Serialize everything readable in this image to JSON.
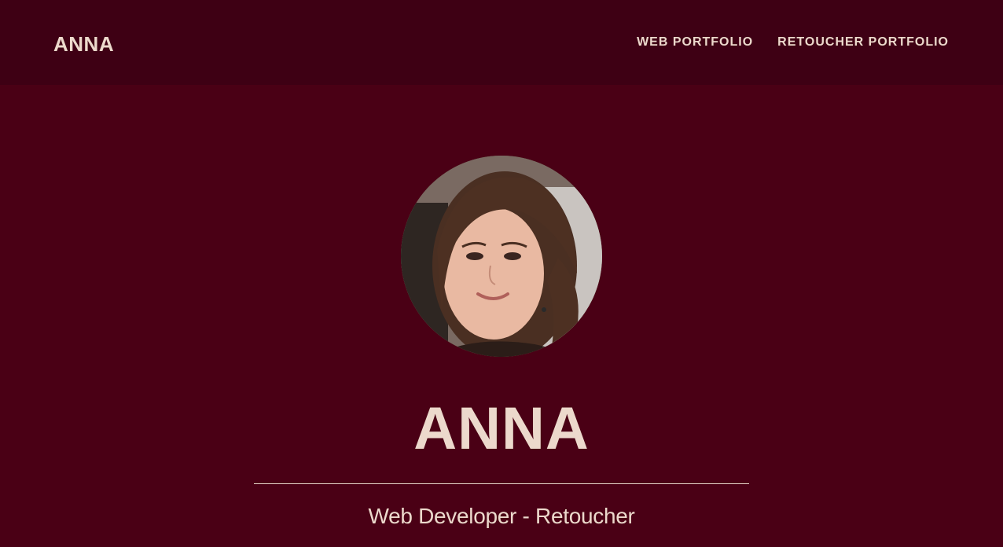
{
  "navbar": {
    "brand": "ANNA",
    "links": [
      "WEB PORTFOLIO",
      "RETOUCHER PORTFOLIO"
    ]
  },
  "hero": {
    "avatar_icon": "profile-photo",
    "title": "ANNA",
    "subtitle": "Web Developer - Retoucher"
  },
  "colors": {
    "background": "#4a0015",
    "navbar": "#3e0014",
    "text": "#ecd9cc"
  }
}
